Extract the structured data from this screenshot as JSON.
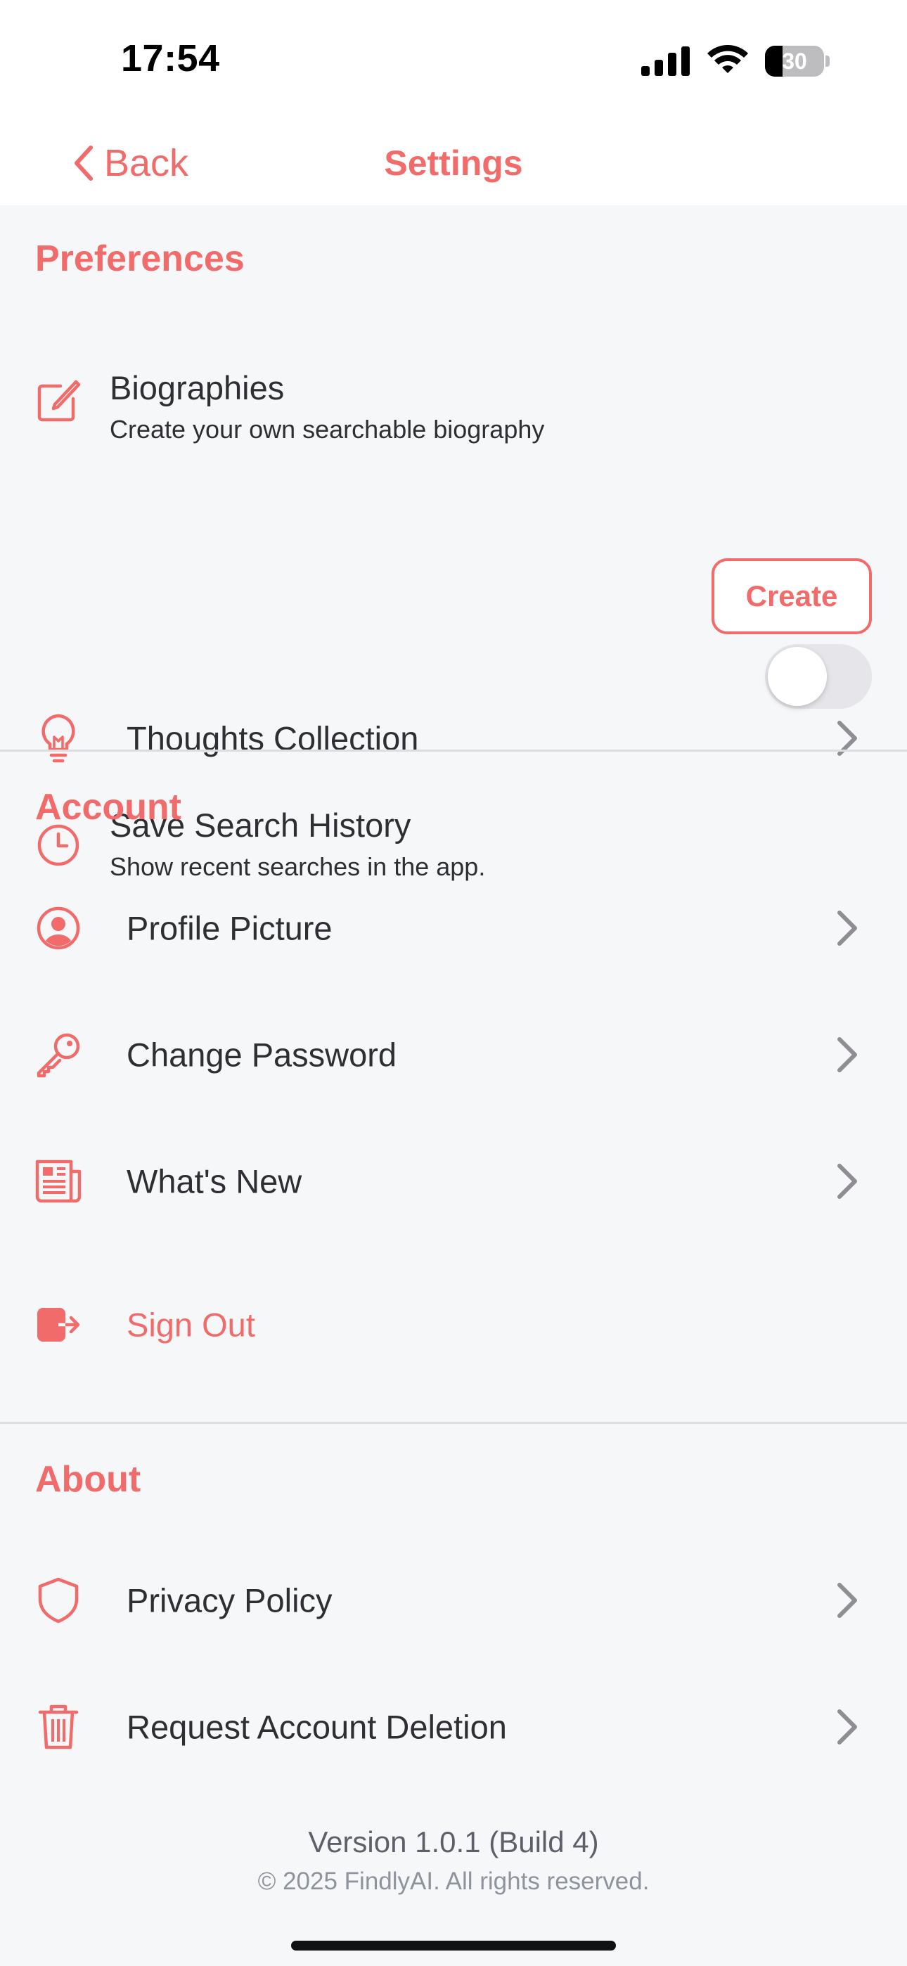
{
  "status_bar": {
    "time": "17:54",
    "battery_percent": "30",
    "battery_level": 0.3
  },
  "nav": {
    "back_label": "Back",
    "title": "Settings"
  },
  "sections": {
    "preferences": {
      "title": "Preferences",
      "biographies": {
        "label": "Biographies",
        "subtitle": "Create your own searchable biography",
        "button": "Create",
        "icon": "edit-icon"
      },
      "thoughts": {
        "label": "Thoughts Collection",
        "icon": "lightbulb-icon"
      },
      "search_history": {
        "label": "Save Search History",
        "subtitle": "Show recent searches in the app.",
        "enabled": false,
        "icon": "clock-icon"
      }
    },
    "account": {
      "title": "Account",
      "profile_picture": {
        "label": "Profile Picture",
        "icon": "user-circle-icon"
      },
      "change_password": {
        "label": "Change Password",
        "icon": "key-icon"
      },
      "whats_new": {
        "label": "What's New",
        "icon": "newspaper-icon"
      },
      "sign_out": {
        "label": "Sign Out",
        "icon": "sign-out-icon"
      }
    },
    "about": {
      "title": "About",
      "privacy_policy": {
        "label": "Privacy Policy",
        "icon": "shield-icon"
      },
      "account_deletion": {
        "label": "Request Account Deletion",
        "icon": "trash-icon"
      }
    }
  },
  "footer": {
    "version": "Version 1.0.1 (Build 4)",
    "copyright": "© 2025 FindlyAI. All rights reserved."
  },
  "colors": {
    "accent": "#f26b6b",
    "background": "#f6f7f9",
    "text": "#2e2e33",
    "chevron": "#8e8e93"
  }
}
